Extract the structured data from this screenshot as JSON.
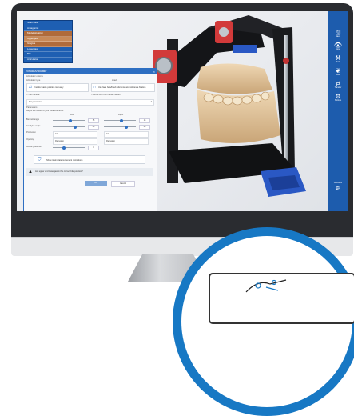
{
  "layers_panel": {
    "items": [
      {
        "label": "Scan data",
        "state": "normal"
      },
      {
        "label": "Antagonist",
        "state": "normal"
      },
      {
        "label": "Model situation",
        "state": "highlight"
      },
      {
        "label": "Upper jaw",
        "state": "highlight2"
      },
      {
        "label": "Gingiva",
        "state": "highlight"
      },
      {
        "label": "Lower jaw",
        "state": "normal"
      },
      {
        "label": "Bite",
        "state": "normal"
      },
      {
        "label": "Articulator",
        "state": "normal"
      }
    ]
  },
  "dialog": {
    "title": "Virtual Articulator",
    "section_label": "Articulator options",
    "values_label": "Articulator type",
    "load_label": "Load",
    "option_left": "Transfer paste position manually",
    "option_right": "Use face bow/fixed reference and reference fixation",
    "checkbox_left": "Set camera",
    "checkbox_right": "Move with both model halves",
    "dropdown": "Set parameter",
    "params_label": "Parameters",
    "params_sub": "Adjust the values to your measurements",
    "col_left": "Left",
    "col_right": "Right",
    "rows": [
      {
        "label": "Bennett angle",
        "left": "15",
        "right": "15"
      },
      {
        "label": "Condylar angle",
        "left": "40",
        "right": "40"
      },
      {
        "label": "Protrusion",
        "left": "0.0",
        "right": "0.0"
      },
      {
        "label": "Opening",
        "left": "Retrusion",
        "right": "Retrusion"
      }
    ],
    "incisal_label": "Incisal guidance",
    "incisal_value": "0",
    "big_button": "Show & simulate movement restrictions",
    "warning_text": "Are upper and lower jaw in the correct bite position?",
    "ok_label": "OK",
    "cancel_label": "Cancel"
  },
  "toolbar": {
    "items": [
      {
        "icon": "save-icon",
        "glyph": "🖫",
        "label": "Save"
      },
      {
        "icon": "view-icon",
        "glyph": "👁",
        "label": "View"
      },
      {
        "icon": "tools-icon",
        "glyph": "⚒",
        "label": "Tools"
      },
      {
        "icon": "model-icon",
        "glyph": "🦷",
        "label": "Model"
      },
      {
        "icon": "transfer-icon",
        "glyph": "⇄",
        "label": "Transfer"
      },
      {
        "icon": "settings-icon",
        "glyph": "⚙",
        "label": "Settings"
      }
    ],
    "bottom_label": "Articulator"
  },
  "colors": {
    "accent": "#1d5cad",
    "badge_ring": "#1778c4",
    "mount_red": "#d23a3a",
    "mount_blue": "#2a58c4"
  }
}
